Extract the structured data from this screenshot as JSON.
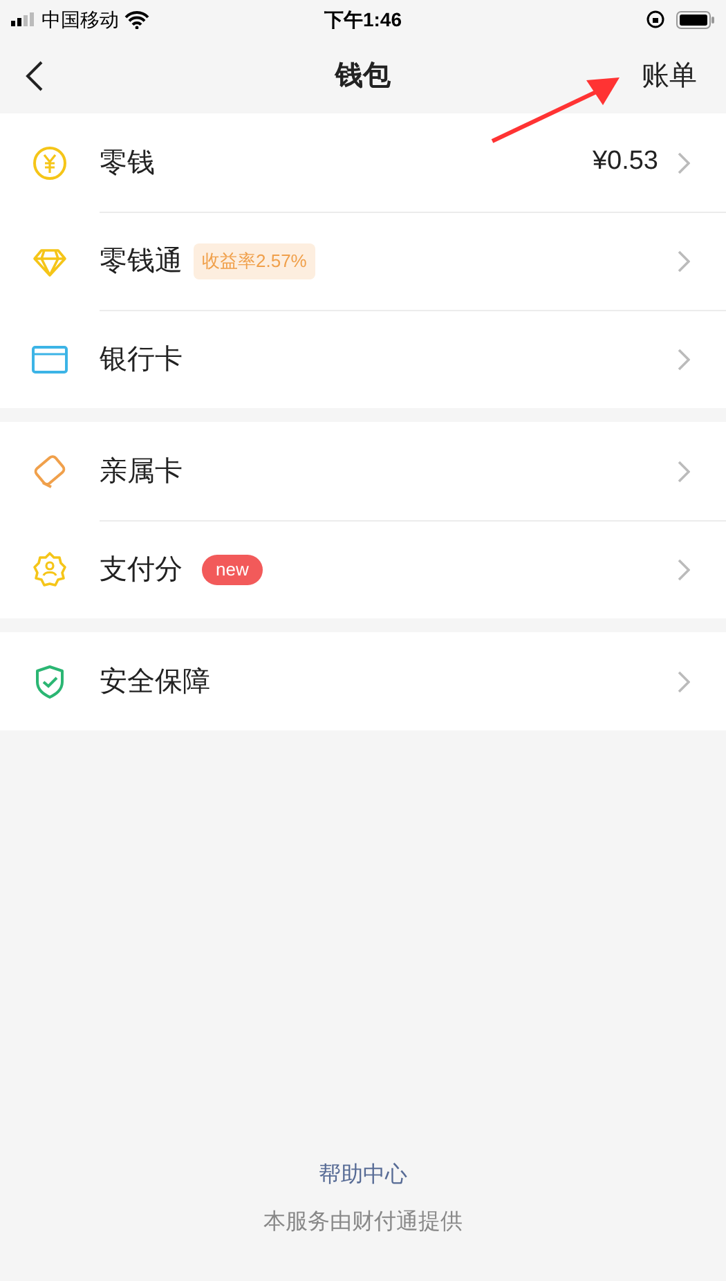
{
  "status_bar": {
    "carrier": "中国移动",
    "time": "下午1:46"
  },
  "nav": {
    "title": "钱包",
    "action": "账单"
  },
  "groups": [
    {
      "items": [
        {
          "kind": "coin",
          "label": "零钱",
          "value": "¥0.53"
        },
        {
          "kind": "diamond",
          "label": "零钱通",
          "badge": {
            "kind": "rate",
            "text": "收益率2.57%"
          }
        },
        {
          "kind": "card",
          "label": "银行卡"
        }
      ]
    },
    {
      "items": [
        {
          "kind": "family-card",
          "label": "亲属卡"
        },
        {
          "kind": "score",
          "label": "支付分",
          "badge": {
            "kind": "new",
            "text": "new"
          }
        }
      ]
    },
    {
      "items": [
        {
          "kind": "shield",
          "label": "安全保障"
        }
      ]
    }
  ],
  "footer": {
    "link": "帮助中心",
    "note": "本服务由财付通提供"
  }
}
